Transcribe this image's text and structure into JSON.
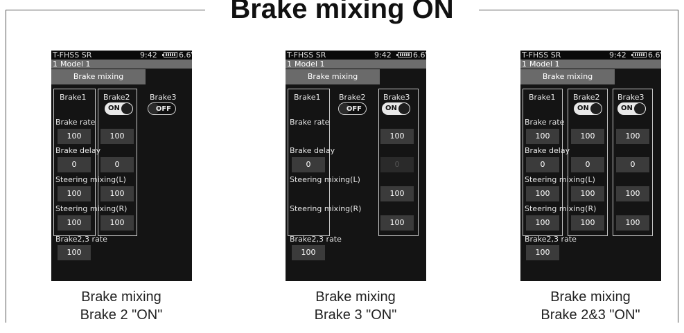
{
  "title": "Brake mixing ON",
  "screens": [
    {
      "status": {
        "system": "T-FHSS SR",
        "time": "9:42",
        "voltage": "6.6V"
      },
      "model": {
        "number": "1",
        "name": "Model 1"
      },
      "tab": "Brake mixing",
      "headers": [
        "Brake1",
        "Brake2",
        "Brake3"
      ],
      "toggles": {
        "brake2": "ON",
        "brake3": "OFF"
      },
      "labels": {
        "rate": "Brake rate",
        "delay": "Brake delay",
        "steer_l": "Steering mixing(L)",
        "steer_r": "Steering mixing(R)",
        "b23": "Brake2,3 rate"
      },
      "brake1": {
        "rate": "100",
        "delay": "0",
        "steer_l": "100",
        "steer_r": "100"
      },
      "brake2": {
        "rate": "100",
        "delay": "0",
        "steer_l": "100",
        "steer_r": "100"
      },
      "b23_rate": "100",
      "caption": [
        "Brake mixing",
        "Brake 2 \"ON\""
      ]
    },
    {
      "status": {
        "system": "T-FHSS SR",
        "time": "9:42",
        "voltage": "6.6V"
      },
      "model": {
        "number": "1",
        "name": "Model 1"
      },
      "tab": "Brake mixing",
      "headers": [
        "Brake1",
        "Brake2",
        "Brake3"
      ],
      "toggles": {
        "brake2": "OFF",
        "brake3": "ON"
      },
      "labels": {
        "rate": "Brake rate",
        "delay": "Brake delay",
        "steer_l": "Steering mixing(L)",
        "steer_r": "Steering mixing(R)",
        "b23": "Brake2,3 rate"
      },
      "brake1": {
        "delay": "0"
      },
      "brake3": {
        "rate": "100",
        "delay": "0",
        "steer_l": "100",
        "steer_r": "100"
      },
      "b23_rate": "100",
      "caption": [
        "Brake mixing",
        "Brake 3 \"ON\""
      ]
    },
    {
      "status": {
        "system": "T-FHSS SR",
        "time": "9:42",
        "voltage": "6.6V"
      },
      "model": {
        "number": "1",
        "name": "Model 1"
      },
      "tab": "Brake mixing",
      "headers": [
        "Brake1",
        "Brake2",
        "Brake3"
      ],
      "toggles": {
        "brake2": "ON",
        "brake3": "ON"
      },
      "labels": {
        "rate": "Brake rate",
        "delay": "Brake delay",
        "steer_l": "Steering mixing(L)",
        "steer_r": "Steering mixing(R)",
        "b23": "Brake2,3 rate"
      },
      "brake1": {
        "rate": "100",
        "delay": "0",
        "steer_l": "100",
        "steer_r": "100"
      },
      "brake2": {
        "rate": "100",
        "delay": "0",
        "steer_l": "100",
        "steer_r": "100"
      },
      "brake3": {
        "rate": "100",
        "delay": "0",
        "steer_l": "100",
        "steer_r": "100"
      },
      "b23_rate": "100",
      "caption": [
        "Brake mixing",
        "Brake 2&3 \"ON\""
      ]
    }
  ]
}
